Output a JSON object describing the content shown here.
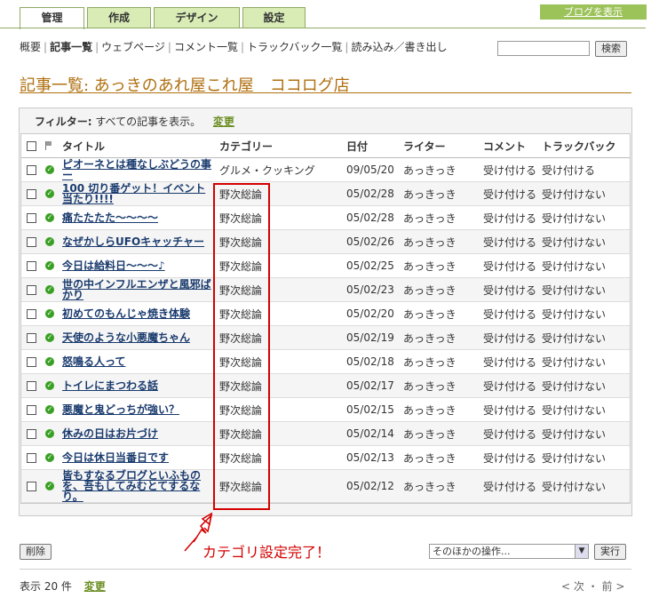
{
  "tabs": [
    "管理",
    "作成",
    "デザイン",
    "設定"
  ],
  "blog_link": "ブログを表示",
  "subnav": [
    "概要",
    "記事一覧",
    "ウェブページ",
    "コメント一覧",
    "トラックバック一覧",
    "読み込み／書き出し"
  ],
  "search_button": "検索",
  "page_title": "記事一覧: あっきのあれ屋これ屋　ココログ店",
  "filter": {
    "label": "フィルター:",
    "value": "すべての記事を表示。",
    "change": "変更"
  },
  "columns": {
    "title": "タイトル",
    "category": "カテゴリー",
    "date": "日付",
    "writer": "ライター",
    "comment": "コメント",
    "trackback": "トラックバック"
  },
  "rows": [
    {
      "title": "ピオーネとは種なしぶどうの事ー",
      "category": "グルメ・クッキング",
      "date": "09/05/20",
      "writer": "あっきっき",
      "comment": "受け付ける",
      "trackback": "受け付ける"
    },
    {
      "title": "100 切り番ゲット！イベント当たり!!!!",
      "category": "野次総論",
      "date": "05/02/28",
      "writer": "あっきっき",
      "comment": "受け付ける",
      "trackback": "受け付けない"
    },
    {
      "title": "痛たたたた～～～～",
      "category": "野次総論",
      "date": "05/02/28",
      "writer": "あっきっき",
      "comment": "受け付ける",
      "trackback": "受け付けない"
    },
    {
      "title": "なぜかしらUFOキャッチャー",
      "category": "野次総論",
      "date": "05/02/26",
      "writer": "あっきっき",
      "comment": "受け付ける",
      "trackback": "受け付けない"
    },
    {
      "title": "今日は給料日～～～♪",
      "category": "野次総論",
      "date": "05/02/25",
      "writer": "あっきっき",
      "comment": "受け付ける",
      "trackback": "受け付けない"
    },
    {
      "title": "世の中インフルエンザと風邪ばかり",
      "category": "野次総論",
      "date": "05/02/23",
      "writer": "あっきっき",
      "comment": "受け付ける",
      "trackback": "受け付けない"
    },
    {
      "title": "初めてのもんじゃ焼き体験",
      "category": "野次総論",
      "date": "05/02/20",
      "writer": "あっきっき",
      "comment": "受け付ける",
      "trackback": "受け付けない"
    },
    {
      "title": "天使のような小悪魔ちゃん",
      "category": "野次総論",
      "date": "05/02/19",
      "writer": "あっきっき",
      "comment": "受け付ける",
      "trackback": "受け付けない"
    },
    {
      "title": "怒鳴る人って",
      "category": "野次総論",
      "date": "05/02/18",
      "writer": "あっきっき",
      "comment": "受け付ける",
      "trackback": "受け付けない"
    },
    {
      "title": "トイレにまつわる話",
      "category": "野次総論",
      "date": "05/02/17",
      "writer": "あっきっき",
      "comment": "受け付ける",
      "trackback": "受け付けない"
    },
    {
      "title": "悪魔と鬼どっちが強い？",
      "category": "野次総論",
      "date": "05/02/15",
      "writer": "あっきっき",
      "comment": "受け付ける",
      "trackback": "受け付けない"
    },
    {
      "title": "休みの日はお片づけ",
      "category": "野次総論",
      "date": "05/02/14",
      "writer": "あっきっき",
      "comment": "受け付ける",
      "trackback": "受け付けない"
    },
    {
      "title": "今日は休日当番日です",
      "category": "野次総論",
      "date": "05/02/13",
      "writer": "あっきっき",
      "comment": "受け付ける",
      "trackback": "受け付けない"
    },
    {
      "title": "皆もすなるブログといふものを、吾もしてみむとてするなり。",
      "category": "野次総論",
      "date": "05/02/12",
      "writer": "あっきっき",
      "comment": "受け付ける",
      "trackback": "受け付けない"
    }
  ],
  "annotation": "カテゴリ設定完了！",
  "delete_button": "削除",
  "other_actions": "そのほかの操作...",
  "execute_button": "実行",
  "display_count": "表示 20 件",
  "count_change": "変更",
  "pager": "< 次 ・ 前 >"
}
